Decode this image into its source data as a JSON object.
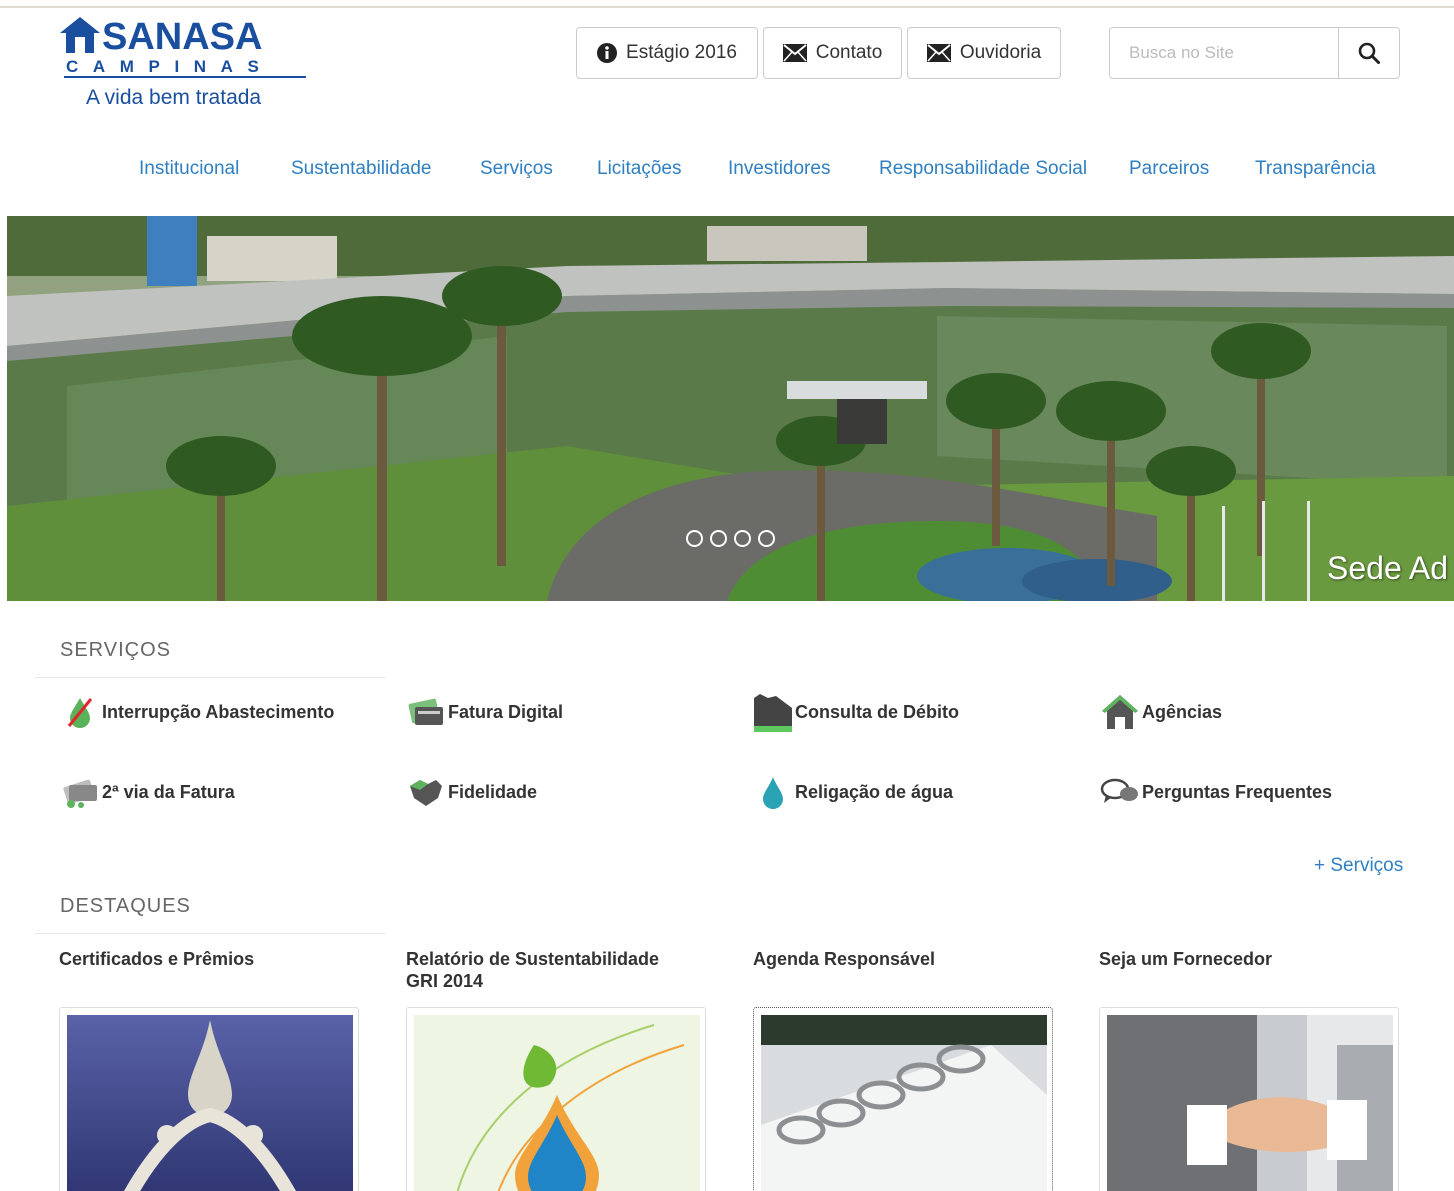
{
  "logo": {
    "name": "SANASA",
    "sub": "CAMPINAS",
    "tagline": "A vida bem tratada",
    "color": "#1a4fa0"
  },
  "top_buttons": {
    "estagio": {
      "label": "Estágio 2016",
      "icon": "info-icon"
    },
    "contato": {
      "label": "Contato",
      "icon": "envelope-icon"
    },
    "ouvidoria": {
      "label": "Ouvidoria",
      "icon": "envelope-icon"
    }
  },
  "search": {
    "placeholder": "Busca no Site",
    "value": "",
    "icon": "search-icon"
  },
  "nav": {
    "items": [
      {
        "label": "Institucional"
      },
      {
        "label": "Sustentabilidade"
      },
      {
        "label": "Serviços"
      },
      {
        "label": "Licitações"
      },
      {
        "label": "Investidores"
      },
      {
        "label": "Responsabilidade Social"
      },
      {
        "label": "Parceiros"
      },
      {
        "label": "Transparência"
      }
    ],
    "color": "#2f7fc1"
  },
  "hero": {
    "caption": "Sede Ad",
    "slide_count": 4,
    "active_slide": 1
  },
  "servicos": {
    "title": "SERVIÇOS",
    "items": [
      {
        "label": "Interrupção Abastecimento",
        "icon": "no-water-icon"
      },
      {
        "label": "Fatura Digital",
        "icon": "digital-bill-icon"
      },
      {
        "label": "Consulta de Débito",
        "icon": "debt-query-icon"
      },
      {
        "label": "Agências",
        "icon": "house-icon"
      },
      {
        "label": "2ª via da Fatura",
        "icon": "bill-copy-icon"
      },
      {
        "label": "Fidelidade",
        "icon": "handshake-icon"
      },
      {
        "label": "Religação de água",
        "icon": "water-drop-icon"
      },
      {
        "label": "Perguntas Frequentes",
        "icon": "chat-bubbles-icon"
      }
    ],
    "more": "+ Serviços"
  },
  "destaques": {
    "title": "DESTAQUES",
    "items": [
      {
        "title": "Certificados e Prêmios"
      },
      {
        "title": "Relatório de Sustentabilidade GRI 2014"
      },
      {
        "title": "Agenda Responsável"
      },
      {
        "title": "Seja um Fornecedor"
      }
    ]
  }
}
